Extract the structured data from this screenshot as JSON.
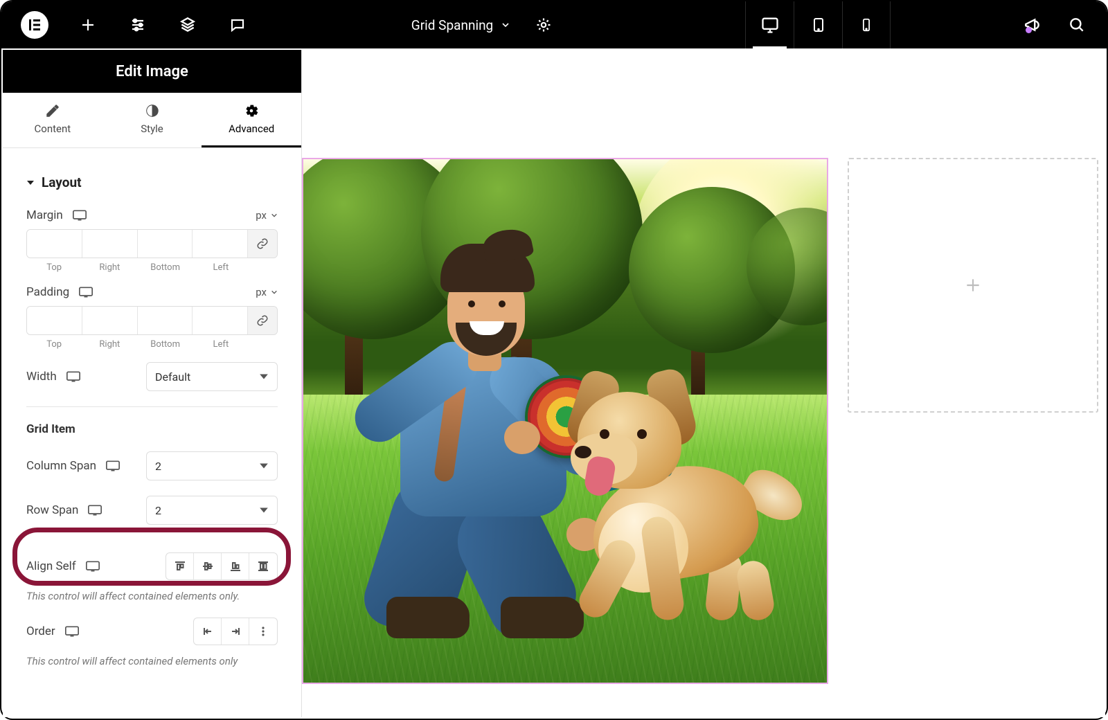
{
  "topbar": {
    "document_title": "Grid Spanning",
    "devices": {
      "desktop_active": true
    }
  },
  "panel": {
    "title": "Edit Image",
    "tabs": {
      "content": "Content",
      "style": "Style",
      "advanced": "Advanced",
      "active": "advanced"
    },
    "section_layout": "Layout",
    "margin": {
      "label": "Margin",
      "unit": "px",
      "top": "",
      "right": "",
      "bottom": "",
      "left": ""
    },
    "padding": {
      "label": "Padding",
      "unit": "px",
      "top": "",
      "right": "",
      "bottom": "",
      "left": ""
    },
    "dim_labels": {
      "top": "Top",
      "right": "Right",
      "bottom": "Bottom",
      "left": "Left"
    },
    "width": {
      "label": "Width",
      "value": "Default"
    },
    "grid_item_head": "Grid Item",
    "column_span": {
      "label": "Column Span",
      "value": "2"
    },
    "row_span": {
      "label": "Row Span",
      "value": "2"
    },
    "align_self": {
      "label": "Align Self"
    },
    "note1": "This control will affect contained elements only.",
    "order": {
      "label": "Order"
    },
    "note2": "This control will affect contained elements only"
  }
}
